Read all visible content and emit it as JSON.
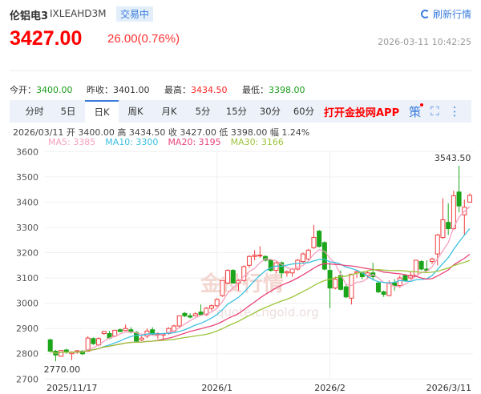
{
  "header": {
    "name": "伦铝电3",
    "code": "IXLEAHD3M",
    "status": "交易中",
    "refresh_label": "刷新行情",
    "price": "3427.00",
    "change": "26.00(0.76%)",
    "datetime": "2026-03-11 10:42:25"
  },
  "stats": [
    {
      "label": "今开：",
      "value": "3400.00",
      "color": "g"
    },
    {
      "label": "昨收：",
      "value": "3401.00",
      "color": ""
    },
    {
      "label": "最高：",
      "value": "3434.50",
      "color": "r"
    },
    {
      "label": "最低：",
      "value": "3398.00",
      "color": "g"
    }
  ],
  "tabs": [
    "分时",
    "5日",
    "日K",
    "周K",
    "月K",
    "5分",
    "15分",
    "30分",
    "60分"
  ],
  "active_tab": "日K",
  "app_link": "打开金投网APP",
  "icons": [
    "strategy-icon",
    "fullscreen-icon",
    "more-icon"
  ],
  "info_line": "2026/03/11 开 3400.00 高 3434.50 收 3427.00 低 3398.00 幅 1.24%",
  "ma_legend": [
    {
      "label": "MA5: 3385",
      "color": "#f7a1c0"
    },
    {
      "label": "MA10: 3300",
      "color": "#3cc0e0"
    },
    {
      "label": "MA20: 3195",
      "color": "#e8457a"
    },
    {
      "label": "MA30: 3166",
      "color": "#9bc43a"
    }
  ],
  "colors": {
    "up": "#f03c3c",
    "down": "#1aa51a",
    "accent": "#3b7ddd"
  },
  "watermark": {
    "text": "金投行情",
    "url": "quote.cngold.org"
  },
  "chart_data": {
    "type": "candlestick",
    "ylim": [
      2700,
      3600
    ],
    "yticks": [
      2700,
      2800,
      2900,
      3000,
      3100,
      3200,
      3300,
      3400,
      3500,
      3600
    ],
    "xlabels": [
      {
        "label": "2025/11/17",
        "index": 0
      },
      {
        "label": "2026/1",
        "index": 31
      },
      {
        "label": "2026/2",
        "index": 52
      },
      {
        "label": "2026/3/11",
        "index": 78
      }
    ],
    "annotations": [
      {
        "label": "3543.50",
        "index": 76,
        "value": 3543.5
      },
      {
        "label": "2770.00",
        "index": 1,
        "value": 2770
      }
    ],
    "ohlc": [
      [
        2855,
        2860,
        2805,
        2810
      ],
      [
        2810,
        2815,
        2770,
        2795
      ],
      [
        2790,
        2815,
        2790,
        2813
      ],
      [
        2815,
        2820,
        2800,
        2808
      ],
      [
        2800,
        2810,
        2775,
        2805
      ],
      [
        2808,
        2815,
        2800,
        2812
      ],
      [
        2810,
        2815,
        2795,
        2800
      ],
      [
        2810,
        2870,
        2808,
        2862
      ],
      [
        2860,
        2865,
        2835,
        2840
      ],
      [
        2835,
        2865,
        2830,
        2860
      ],
      [
        2880,
        2890,
        2875,
        2888
      ],
      [
        2880,
        2890,
        2858,
        2862
      ],
      [
        2870,
        2895,
        2865,
        2893
      ],
      [
        2895,
        2900,
        2885,
        2888
      ],
      [
        2892,
        2915,
        2890,
        2900
      ],
      [
        2895,
        2905,
        2880,
        2885
      ],
      [
        2885,
        2890,
        2845,
        2850
      ],
      [
        2855,
        2870,
        2850,
        2862
      ],
      [
        2870,
        2900,
        2862,
        2890
      ],
      [
        2895,
        2905,
        2875,
        2877
      ],
      [
        2875,
        2885,
        2860,
        2880
      ],
      [
        2875,
        2880,
        2855,
        2877
      ],
      [
        2880,
        2905,
        2875,
        2900
      ],
      [
        2890,
        2915,
        2885,
        2910
      ],
      [
        2910,
        2950,
        2905,
        2950
      ],
      [
        2960,
        2965,
        2945,
        2950
      ],
      [
        2950,
        2960,
        2940,
        2945
      ],
      [
        2950,
        2965,
        2950,
        2958
      ],
      [
        2965,
        2995,
        2955,
        2955
      ],
      [
        2955,
        2985,
        2950,
        2980
      ],
      [
        2980,
        2995,
        2970,
        2990
      ],
      [
        2990,
        3020,
        2985,
        3015
      ],
      [
        3030,
        3090,
        3025,
        3090
      ],
      [
        3080,
        3135,
        3075,
        3130
      ],
      [
        3130,
        3135,
        3080,
        3080
      ],
      [
        3080,
        3095,
        3050,
        3090
      ],
      [
        3090,
        3150,
        3085,
        3145
      ],
      [
        3150,
        3190,
        3140,
        3185
      ],
      [
        3185,
        3210,
        3170,
        3190
      ],
      [
        3190,
        3225,
        3180,
        3190
      ],
      [
        3185,
        3190,
        3165,
        3170
      ],
      [
        3170,
        3175,
        3125,
        3130
      ],
      [
        3130,
        3165,
        3120,
        3160
      ],
      [
        3160,
        3165,
        3100,
        3120
      ],
      [
        3120,
        3130,
        3105,
        3125
      ],
      [
        3120,
        3140,
        3105,
        3135
      ],
      [
        3135,
        3175,
        3130,
        3170
      ],
      [
        3165,
        3200,
        3155,
        3195
      ],
      [
        3175,
        3215,
        3170,
        3210
      ],
      [
        3220,
        3310,
        3215,
        3260
      ],
      [
        3285,
        3290,
        3220,
        3225
      ],
      [
        3240,
        3245,
        3130,
        3135
      ],
      [
        3130,
        3160,
        2980,
        3060
      ],
      [
        3060,
        3105,
        3055,
        3095
      ],
      [
        3110,
        3130,
        3050,
        3055
      ],
      [
        3065,
        3075,
        3020,
        3025
      ],
      [
        3020,
        3115,
        2995,
        3115
      ],
      [
        3120,
        3130,
        3100,
        3125
      ],
      [
        3120,
        3125,
        3095,
        3105
      ],
      [
        3110,
        3125,
        3100,
        3120
      ],
      [
        3120,
        3160,
        3090,
        3105
      ],
      [
        3080,
        3085,
        3040,
        3045
      ],
      [
        3045,
        3050,
        3025,
        3035
      ],
      [
        3030,
        3090,
        3030,
        3080
      ],
      [
        3080,
        3095,
        3050,
        3070
      ],
      [
        3070,
        3110,
        3060,
        3100
      ],
      [
        3110,
        3115,
        3085,
        3090
      ],
      [
        3100,
        3125,
        3095,
        3110
      ],
      [
        3110,
        3170,
        3105,
        3170
      ],
      [
        3165,
        3170,
        3130,
        3135
      ],
      [
        3135,
        3170,
        3125,
        3130
      ],
      [
        3165,
        3180,
        3155,
        3175
      ],
      [
        3195,
        3275,
        3150,
        3270
      ],
      [
        3260,
        3415,
        3255,
        3330
      ],
      [
        3320,
        3395,
        3270,
        3295
      ],
      [
        3295,
        3445,
        3290,
        3425
      ],
      [
        3440,
        3543.5,
        3360,
        3385
      ],
      [
        3350,
        3410,
        3270,
        3380
      ],
      [
        3400,
        3434.5,
        3398,
        3427
      ]
    ]
  }
}
